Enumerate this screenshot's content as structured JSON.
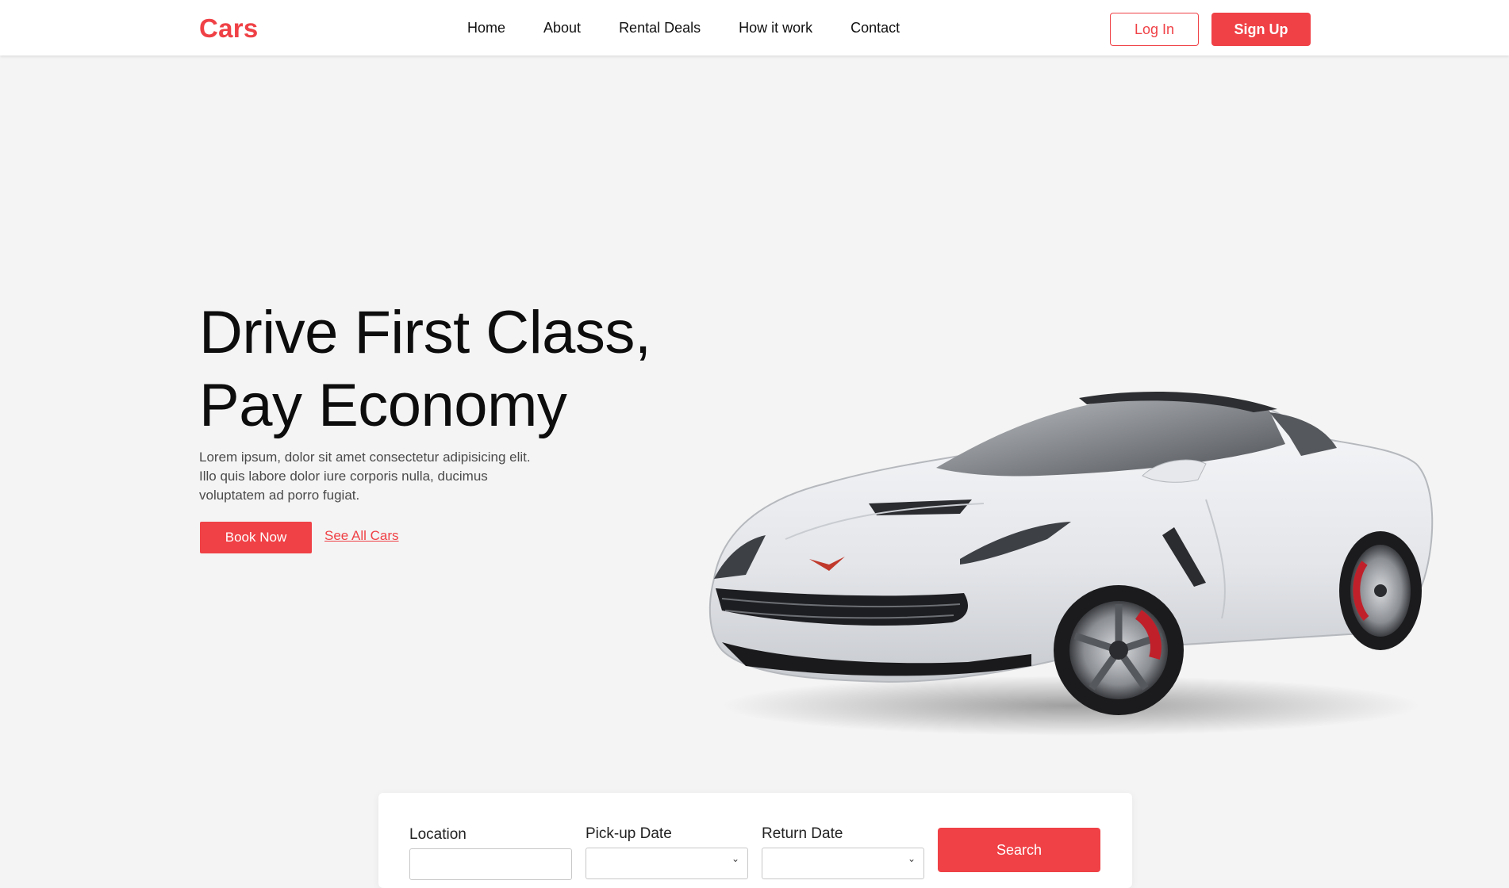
{
  "brand": {
    "logo_text": "Cars",
    "accent_color": "#ef4146"
  },
  "nav": {
    "links": [
      "Home",
      "About",
      "Rental Deals",
      "How it work",
      "Contact"
    ],
    "login_label": "Log In",
    "signup_label": "Sign Up"
  },
  "hero": {
    "title_line1": "Drive First Class,",
    "title_line2": "Pay Economy",
    "description": "Lorem ipsum, dolor sit amet consectetur adipisicing elit. Illo quis labore dolor iure corporis nulla, ducimus voluptatem ad porro fugiat.",
    "book_label": "Book Now",
    "see_all_label": "See All Cars",
    "car_image_icon": "sports-car-image"
  },
  "search": {
    "location_label": "Location",
    "pickup_label": "Pick-up Date",
    "return_label": "Return Date",
    "button_label": "Search"
  }
}
